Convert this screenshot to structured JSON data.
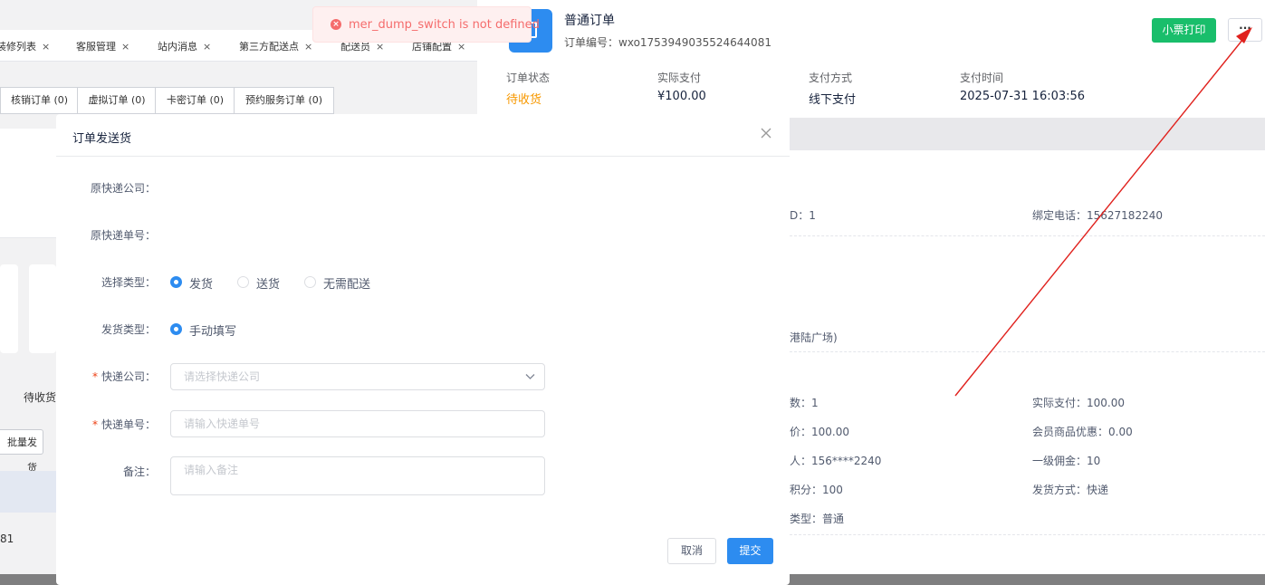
{
  "bg": {
    "tabs": [
      {
        "label": "装修列表"
      },
      {
        "label": "客服管理"
      },
      {
        "label": "站内消息"
      },
      {
        "label": "第三方配送点"
      },
      {
        "label": "配送员"
      },
      {
        "label": "店铺配置"
      }
    ],
    "subtabs": [
      "核销订单 (0)",
      "虚拟订单 (0)",
      "卡密订单 (0)",
      "预约服务订单 (0)"
    ],
    "status_tab": "待收货",
    "bulk_ship": "批量发货",
    "row_tail": "81"
  },
  "drawer": {
    "title": "普通订单",
    "order_no_label": "订单编号：",
    "order_no": "wxo1753949035524644081",
    "print_label": "小票打印",
    "more_label": "···",
    "summary": [
      {
        "label": "订单状态",
        "value": "待收货",
        "color": "#f79800"
      },
      {
        "label": "实际支付",
        "value": "¥100.00",
        "color": "#17233d"
      },
      {
        "label": "支付方式",
        "value": "线下支付",
        "color": "#17233d"
      },
      {
        "label": "支付时间",
        "value": "2025-07-31 16:03:56",
        "color": "#17233d"
      }
    ],
    "user_id": "D：1",
    "phone": "绑定电话：15627182240",
    "address_tail": "港陆广场)",
    "items_left": [
      "数：1",
      "价：100.00",
      "人：156****2240",
      "积分：100",
      "类型：普通"
    ],
    "items_right": [
      "实际支付：100.00",
      "会员商品优惠：0.00",
      "一级佣金：10",
      "发货方式：快递"
    ]
  },
  "modal": {
    "title": "订单发送货",
    "original_company_label": "原快递公司：",
    "original_no_label": "原快递单号：",
    "select_type_label": "选择类型：",
    "select_type_options": [
      "发货",
      "送货",
      "无需配送"
    ],
    "ship_type_label": "发货类型：",
    "ship_type_option": "手动填写",
    "company_label": "快递公司：",
    "company_placeholder": "请选择快递公司",
    "tracking_label": "快递单号：",
    "tracking_placeholder": "请输入快递单号",
    "remark_label": "备注：",
    "remark_placeholder": "请输入备注",
    "cancel_label": "取消",
    "submit_label": "提交"
  },
  "toast": {
    "message": "mer_dump_switch is not defined"
  },
  "colors": {
    "primary": "#2d8cf0",
    "success": "#19be6b",
    "error": "#f56c6c",
    "warning": "#f79800",
    "annotation_arrow": "#e0211d"
  }
}
